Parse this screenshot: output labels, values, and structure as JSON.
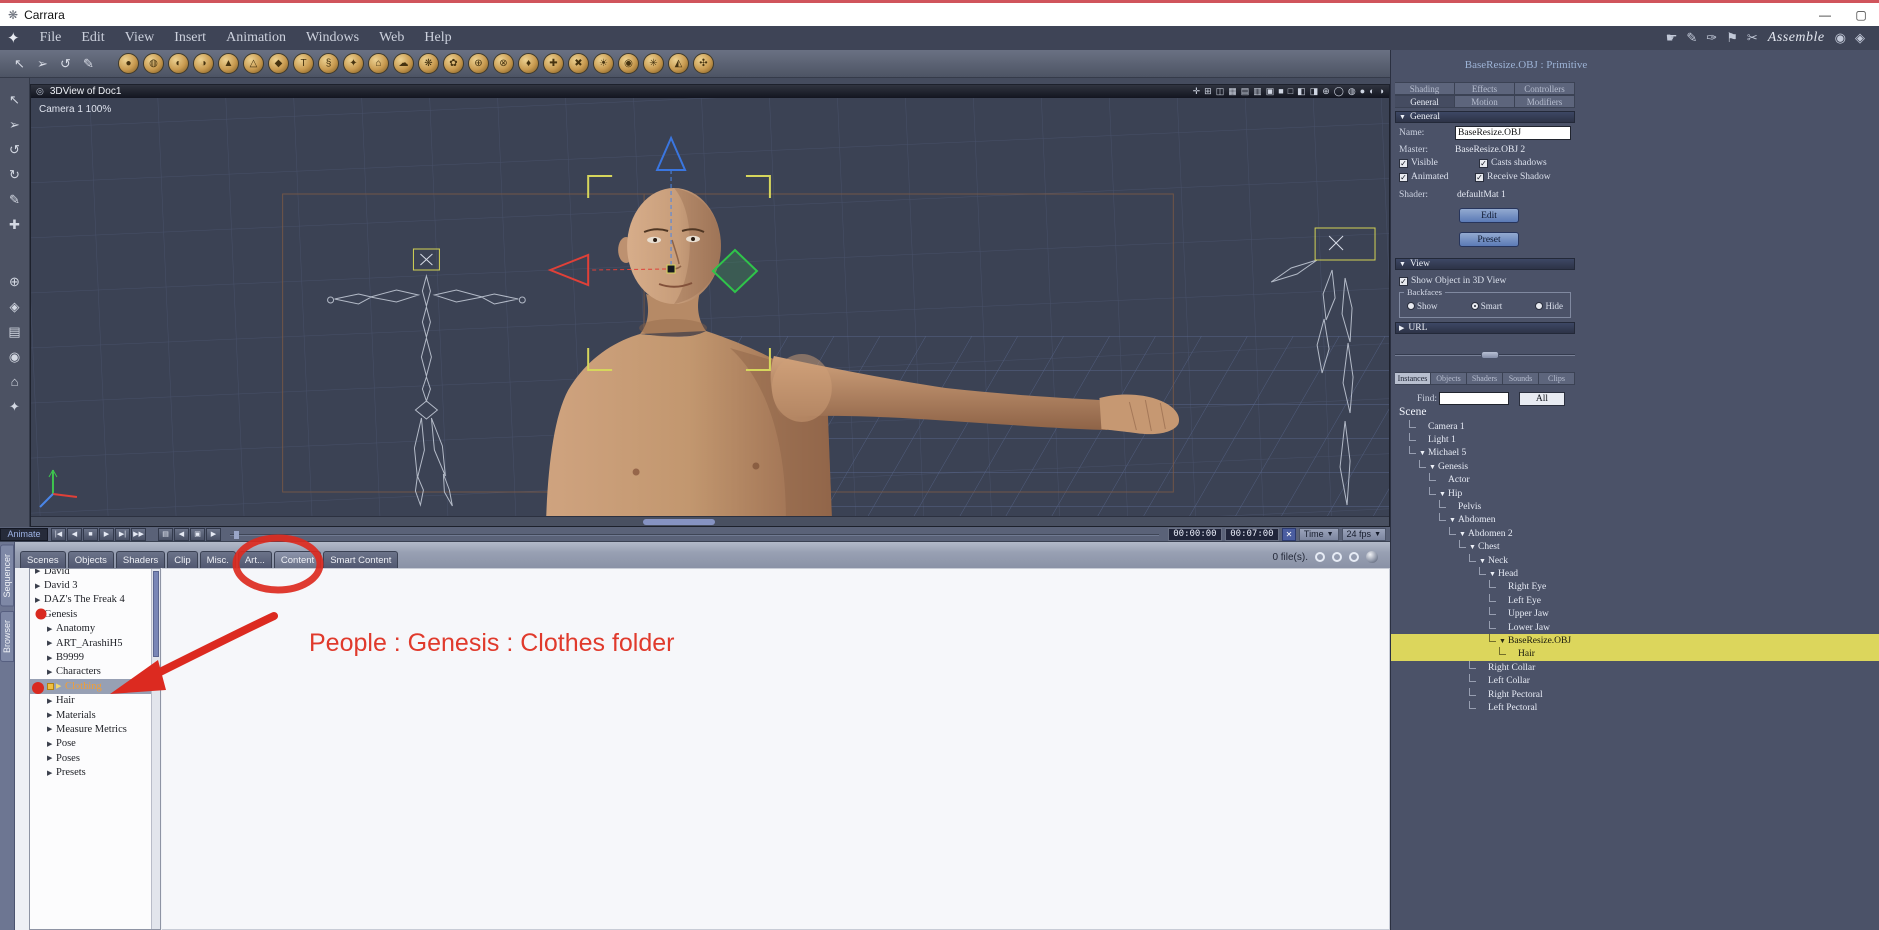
{
  "titlebar": {
    "title": "Carrara"
  },
  "menubar": {
    "items": [
      "File",
      "Edit",
      "View",
      "Insert",
      "Animation",
      "Windows",
      "Web",
      "Help"
    ],
    "right_icons": [
      "☛",
      "✎",
      "✑",
      "⚑",
      "✂"
    ],
    "mode_label": "Assemble",
    "right_end_icons": [
      "◉",
      "◈"
    ]
  },
  "toolbar": {
    "tools": [
      "↖",
      "➢",
      "↺",
      "✎"
    ],
    "objects": [
      "●",
      "◍",
      "◐",
      "◑",
      "▲",
      "△",
      "◆",
      "T",
      "§",
      "✦",
      "⌂",
      "☁",
      "❋",
      "✿",
      "⊕",
      "⊗",
      "♦",
      "✚",
      "✖",
      "☀",
      "◉",
      "✳",
      "◭",
      "✣"
    ]
  },
  "leftstrip": {
    "tools_top": [
      "↖",
      "➢",
      "↺",
      "↻",
      "✎",
      "✚"
    ],
    "tools_bottom": [
      "⊕",
      "◈",
      "▤",
      "◉",
      "⌂",
      "✦"
    ]
  },
  "viewport": {
    "title": "3DView of Doc1",
    "camera_label": "Camera 1 100%",
    "header_icons": [
      "✛",
      "⊞",
      "◫",
      "▦",
      "▤",
      "▥",
      "▣",
      "■",
      "□",
      "◧",
      "◨",
      "⊕",
      "◯",
      "◍",
      "●",
      "◐",
      "◑"
    ]
  },
  "timeline": {
    "animate": "Animate",
    "transport": [
      "|◀",
      "◀",
      "■",
      "▶",
      "▶|",
      "▶▶"
    ],
    "extra": [
      "▤",
      "◀",
      "▣",
      "▶"
    ],
    "time_current": "00:00:00",
    "time_total": "00:07:00",
    "time_mode": "Time",
    "fps": "24 fps"
  },
  "sidetabs": [
    "Sequencer",
    "Browser"
  ],
  "bottom": {
    "tabs": [
      {
        "label": "Scenes"
      },
      {
        "label": "Objects"
      },
      {
        "label": "Shaders"
      },
      {
        "label": "Clip"
      },
      {
        "label": "Misc."
      },
      {
        "label": "Art..."
      },
      {
        "label": "Content",
        "active": true
      },
      {
        "label": "Smart Content"
      }
    ],
    "status": "0 file(s)."
  },
  "browser": {
    "items": [
      {
        "label": "David",
        "arrow": "▶",
        "depth": 1
      },
      {
        "label": "David 3",
        "arrow": "▶",
        "depth": 1
      },
      {
        "label": "DAZ's The Freak 4",
        "arrow": "▶",
        "depth": 1
      },
      {
        "label": "Genesis",
        "arrow": "▼",
        "depth": 1
      },
      {
        "label": "Anatomy",
        "arrow": "▶",
        "depth": 2
      },
      {
        "label": "ART_ArashiH5",
        "arrow": "▶",
        "depth": 2
      },
      {
        "label": "B9999",
        "arrow": "▶",
        "depth": 2
      },
      {
        "label": "Characters",
        "arrow": "▶",
        "depth": 2
      },
      {
        "label": "Clothing",
        "arrow": "▶",
        "depth": 2,
        "selected": true
      },
      {
        "label": "Hair",
        "arrow": "▶",
        "depth": 2
      },
      {
        "label": "Materials",
        "arrow": "▶",
        "depth": 2
      },
      {
        "label": "Measure Metrics",
        "arrow": "▶",
        "depth": 2
      },
      {
        "label": "Pose",
        "arrow": "▶",
        "depth": 2
      },
      {
        "label": "Poses",
        "arrow": "▶",
        "depth": 2
      },
      {
        "label": "Presets",
        "arrow": "▶",
        "depth": 2
      }
    ]
  },
  "annotation": {
    "text": "People : Genesis : Clothes folder"
  },
  "rpanel": {
    "title": "BaseResize.OBJ : Primitive",
    "tabs_row1": [
      {
        "label": "Shading"
      },
      {
        "label": "Effects"
      },
      {
        "label": "Controllers"
      }
    ],
    "tabs_row2": [
      {
        "label": "General",
        "active": true
      },
      {
        "label": "Motion"
      },
      {
        "label": "Modifiers"
      }
    ],
    "sec_general": "General",
    "sec_general_arrow": "▼",
    "name_label": "Name:",
    "name_value": "BaseResize.OBJ",
    "master_label": "Master:",
    "master_value": "BaseResize.OBJ 2",
    "cb_visible": "Visible",
    "cb_casts": "Casts shadows",
    "cb_animated": "Animated",
    "cb_receive": "Receive Shadow",
    "shader_label": "Shader:",
    "shader_value": "defaultMat 1",
    "edit_btn": "Edit",
    "preset_btn": "Preset",
    "sec_view": "View",
    "sec_view_arrow": "▼",
    "cb_show_object": "Show Object in 3D View",
    "backfaces_label": "Backfaces",
    "radio_show": "Show",
    "radio_smart": "Smart",
    "radio_hide": "Hide",
    "sec_url": "URL",
    "sec_url_arrow": "▶",
    "instance_tabs": [
      {
        "label": "Instances",
        "active": true
      },
      {
        "label": "Objects"
      },
      {
        "label": "Shaders"
      },
      {
        "label": "Sounds"
      },
      {
        "label": "Clips"
      }
    ],
    "find_label": "Find:",
    "all_btn": "All",
    "scene_label": "Scene",
    "tree": [
      {
        "label": "Camera 1",
        "depth": 1,
        "arrow": ""
      },
      {
        "label": "Light 1",
        "depth": 1,
        "arrow": ""
      },
      {
        "label": "Michael 5",
        "depth": 1,
        "arrow": "▼"
      },
      {
        "label": "Genesis",
        "depth": 2,
        "arrow": "▼"
      },
      {
        "label": "Actor",
        "depth": 3,
        "arrow": ""
      },
      {
        "label": "Hip",
        "depth": 3,
        "arrow": "▼"
      },
      {
        "label": "Pelvis",
        "depth": 4,
        "arrow": ""
      },
      {
        "label": "Abdomen",
        "depth": 4,
        "arrow": "▼"
      },
      {
        "label": "Abdomen 2",
        "depth": 5,
        "arrow": "▼"
      },
      {
        "label": "Chest",
        "depth": 6,
        "arrow": "▼"
      },
      {
        "label": "Neck",
        "depth": 7,
        "arrow": "▼"
      },
      {
        "label": "Head",
        "depth": 8,
        "arrow": "▼"
      },
      {
        "label": "Right Eye",
        "depth": 9,
        "arrow": ""
      },
      {
        "label": "Left Eye",
        "depth": 9,
        "arrow": ""
      },
      {
        "label": "Upper Jaw",
        "depth": 9,
        "arrow": ""
      },
      {
        "label": "Lower Jaw",
        "depth": 9,
        "arrow": ""
      },
      {
        "label": "BaseResize.OBJ",
        "depth": 9,
        "arrow": "▼",
        "highlight": true
      },
      {
        "label": "Hair",
        "depth": 10,
        "arrow": "",
        "highlight": true
      },
      {
        "label": "Right Collar",
        "depth": 7,
        "arrow": ""
      },
      {
        "label": "Left Collar",
        "depth": 7,
        "arrow": ""
      },
      {
        "label": "Right Pectoral",
        "depth": 7,
        "arrow": ""
      },
      {
        "label": "Left Pectoral",
        "depth": 7,
        "arrow": ""
      }
    ]
  },
  "colors": {
    "annotation_red": "#dc2a20",
    "highlight_yellow": "#dcd65c",
    "selected_orange": "#f29e35",
    "panel_blue": "#4b5268"
  }
}
